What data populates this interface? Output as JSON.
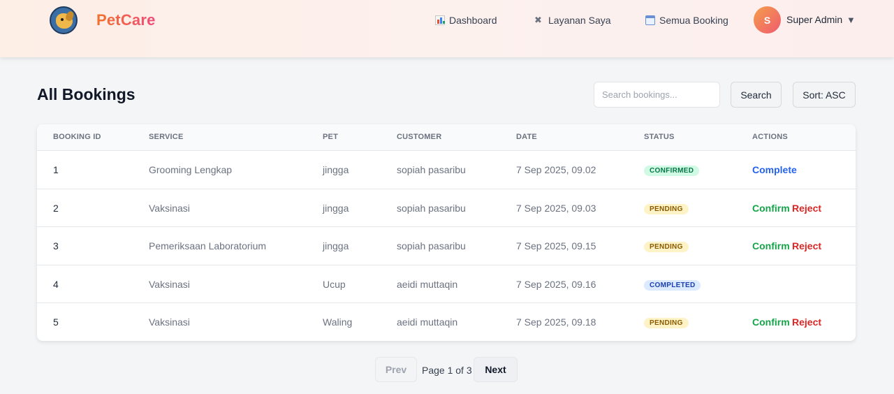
{
  "brand": {
    "name": "PetCare"
  },
  "nav": {
    "items": [
      {
        "label": "Dashboard",
        "icon": "bar-chart-icon"
      },
      {
        "label": "Layanan Saya",
        "icon": "tools-icon"
      },
      {
        "label": "Semua Booking",
        "icon": "calendar-icon"
      }
    ],
    "user": {
      "initial": "S",
      "name": "Super Admin",
      "caret": "▼"
    }
  },
  "page": {
    "title": "All Bookings",
    "search": {
      "placeholder": "Search bookings...",
      "value": ""
    },
    "search_label": "Search",
    "sort_label": "Sort: ASC"
  },
  "table": {
    "headers": [
      "BOOKING ID",
      "SERVICE",
      "PET",
      "CUSTOMER",
      "DATE",
      "STATUS",
      "ACTIONS"
    ],
    "rows": [
      {
        "id": "1",
        "service": "Grooming Lengkap",
        "pet": "jingga",
        "customer": "sopiah pasaribu",
        "date": "7 Sep 2025, 09.02",
        "status": "CONFIRMED",
        "actions": [
          "Complete"
        ]
      },
      {
        "id": "2",
        "service": "Vaksinasi",
        "pet": "jingga",
        "customer": "sopiah pasaribu",
        "date": "7 Sep 2025, 09.03",
        "status": "PENDING",
        "actions": [
          "Confirm",
          "Reject"
        ]
      },
      {
        "id": "3",
        "service": "Pemeriksaan Laboratorium",
        "pet": "jingga",
        "customer": "sopiah pasaribu",
        "date": "7 Sep 2025, 09.15",
        "status": "PENDING",
        "actions": [
          "Confirm",
          "Reject"
        ]
      },
      {
        "id": "4",
        "service": "Vaksinasi",
        "pet": "Ucup",
        "customer": "aeidi muttaqin",
        "date": "7 Sep 2025, 09.16",
        "status": "COMPLETED",
        "actions": []
      },
      {
        "id": "5",
        "service": "Vaksinasi",
        "pet": "Waling",
        "customer": "aeidi muttaqin",
        "date": "7 Sep 2025, 09.18",
        "status": "PENDING",
        "actions": [
          "Confirm",
          "Reject"
        ]
      }
    ]
  },
  "pagination": {
    "prev": "Prev",
    "info": "Page 1 of 3",
    "next": "Next"
  },
  "colors": {
    "accent_orange": "#f3722c",
    "accent_pink": "#ef4b7a",
    "confirmed": "#067647",
    "pending": "#8a5a00",
    "completed": "#1e40af",
    "action_complete": "#2563eb",
    "action_confirm": "#16a34a",
    "action_reject": "#dc2626"
  }
}
